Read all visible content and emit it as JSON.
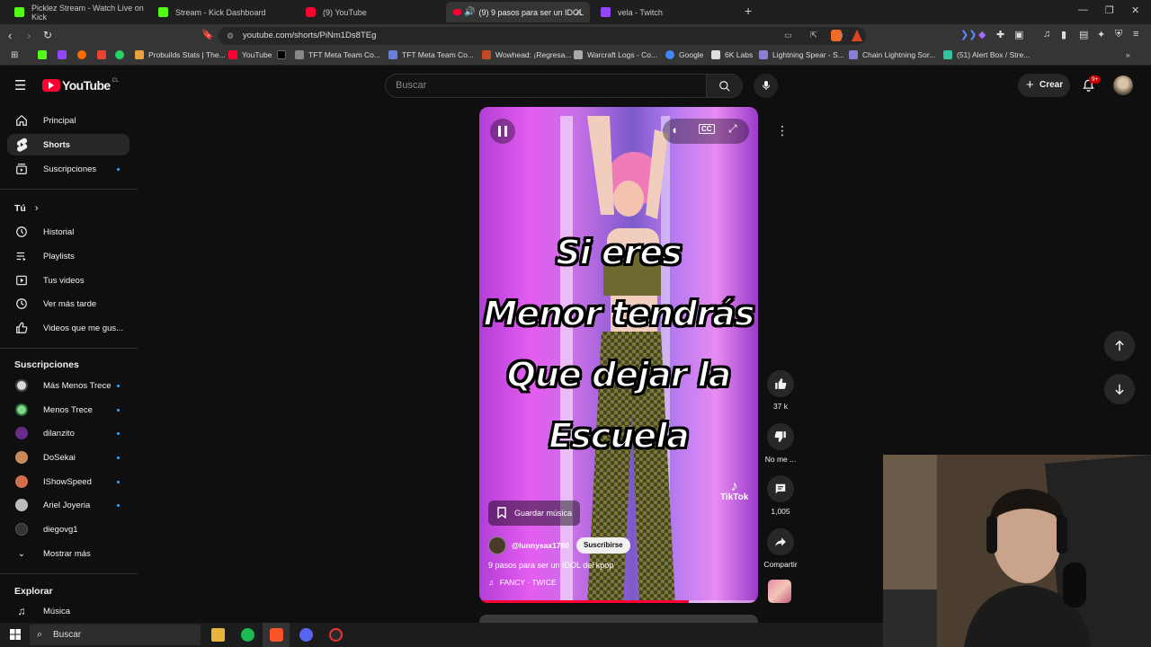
{
  "browser": {
    "tabs": [
      {
        "title": "Picklez Stream - Watch Live on Kick",
        "color": "#53fc18"
      },
      {
        "title": "Stream - Kick Dashboard",
        "color": "#53fc18"
      },
      {
        "title": "(9) YouTube",
        "color": "#ff0033"
      },
      {
        "title": "(9) 9 pasos para ser un IDOL",
        "color": "#ff0033"
      },
      {
        "title": "vela - Twitch",
        "color": "#9146ff"
      }
    ],
    "new_tab": "+",
    "url": "youtube.com/shorts/PiNm1Ds8TEg",
    "bookmarks": [
      {
        "label": "Probuilds Stats | The...",
        "color": "#e8a33d"
      },
      {
        "label": "YouTube",
        "color": "#ff0033"
      },
      {
        "label": "TFT Meta Team Co...",
        "color": "#888"
      },
      {
        "label": "TFT Meta Team Co...",
        "color": "#6a7fd6"
      },
      {
        "label": "Wowhead: ¡Regresa...",
        "color": "#c04a24"
      },
      {
        "label": "Warcraft Logs - Co...",
        "color": "#aaa"
      },
      {
        "label": "Google",
        "color": "#4285f4"
      },
      {
        "label": "6K Labs",
        "color": "#ddd"
      },
      {
        "label": "Lightning Spear - S...",
        "color": "#8a7fd6"
      },
      {
        "label": "Chain Lightning Sor...",
        "color": "#8a7fd6"
      },
      {
        "label": "(51) Alert Box / Stre...",
        "color": "#31c3a2"
      }
    ]
  },
  "youtube": {
    "logo": "YouTube",
    "country": "CL",
    "search_placeholder": "Buscar",
    "create_label": "Crear",
    "notif_badge": "9+"
  },
  "sidebar": {
    "main": [
      {
        "label": "Principal",
        "icon": "home-icon"
      },
      {
        "label": "Shorts",
        "icon": "shorts-icon",
        "active": true
      },
      {
        "label": "Suscripciones",
        "icon": "subscriptions-icon",
        "dot": true
      }
    ],
    "you_header": "Tú",
    "you": [
      {
        "label": "Historial",
        "icon": "history-icon"
      },
      {
        "label": "Playlists",
        "icon": "playlists-icon"
      },
      {
        "label": "Tus videos",
        "icon": "your-videos-icon"
      },
      {
        "label": "Ver más tarde",
        "icon": "watch-later-icon"
      },
      {
        "label": "Videos que me gus...",
        "icon": "liked-icon"
      }
    ],
    "subs_header": "Suscripciones",
    "subs": [
      {
        "label": "Más Menos Trece",
        "color": "#d9d9d9",
        "dot": true
      },
      {
        "label": "Menos Trece",
        "color": "#7fd98a",
        "dot": true
      },
      {
        "label": "dilanzito",
        "color": "#6a2a8a",
        "dot": true
      },
      {
        "label": "DoSekai",
        "color": "#c98a5a",
        "dot": true
      },
      {
        "label": "IShowSpeed",
        "color": "#d0704a",
        "dot": true
      },
      {
        "label": "Ariel Joyeria",
        "color": "#bbbbbb",
        "dot": true
      },
      {
        "label": "diegovg1",
        "color": "#333333",
        "dot": false
      }
    ],
    "show_more": "Mostrar más",
    "explore_header": "Explorar",
    "explore": [
      {
        "label": "Música",
        "icon": "music-icon"
      }
    ]
  },
  "short": {
    "caption_lines": [
      "Si eres",
      "Menor tendrás",
      "Que dejar la",
      "Escuela"
    ],
    "save_music": "Guardar música",
    "channel": "@lunnysax1760",
    "subscribe": "Suscribirse",
    "title": "9 pasos para ser un IDOL del kpop",
    "music": "FANCY · TWICE",
    "watermark": "TikTok",
    "progress_fraction": 0.75
  },
  "actions": {
    "likes": "37 k",
    "dislike": "No me ...",
    "comments": "1,005",
    "share": "Compartir"
  },
  "taskbar": {
    "search": "Buscar"
  }
}
